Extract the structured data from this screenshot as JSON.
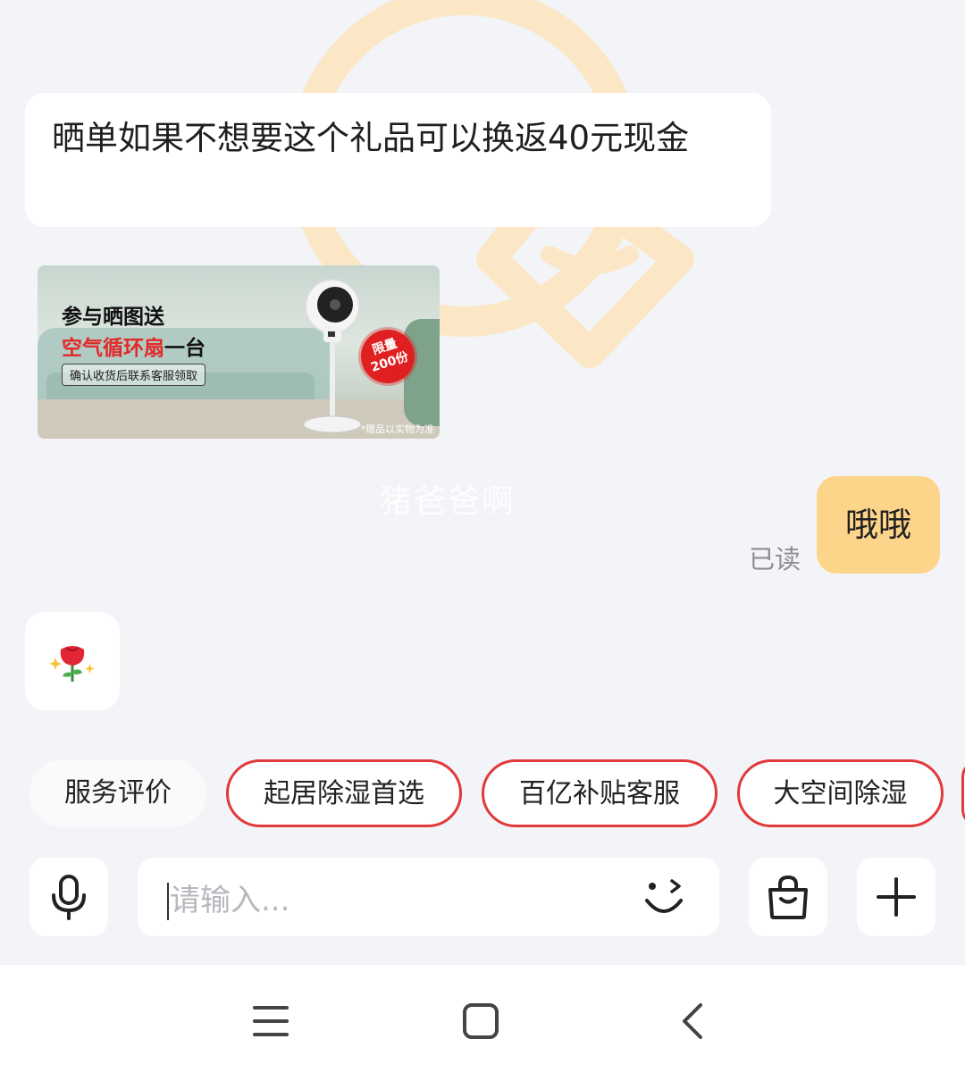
{
  "messages": {
    "agent_text": "晒单如果不想要这个礼品可以换返40元现金",
    "banner": {
      "line1": "参与晒图送",
      "line2_highlight": "空气循环扇",
      "line2_rest": "一台",
      "sub": "确认收货后联系客服领取",
      "badge_top": "限量",
      "badge_bottom": "200份",
      "note": "*赠品以实物为准"
    },
    "watermark": "猪爸爸啊",
    "read_status": "已读",
    "my_text": "哦哦",
    "rose_emoji": "rose-with-sparkles"
  },
  "quick_replies": [
    "服务评价",
    "起居除湿首选",
    "百亿补贴客服",
    "大空间除湿"
  ],
  "input": {
    "placeholder": "请输入..."
  },
  "icons": {
    "mic": "microphone-icon",
    "emoji": "wink-face-icon",
    "bag": "shopping-bag-icon",
    "plus": "plus-icon",
    "nav_menu": "menu-icon",
    "nav_home": "home-square-icon",
    "nav_back": "back-chevron-icon"
  },
  "colors": {
    "accent_red": "#e03a3a",
    "my_bubble": "#fdd58a",
    "background": "#f3f4f8"
  }
}
